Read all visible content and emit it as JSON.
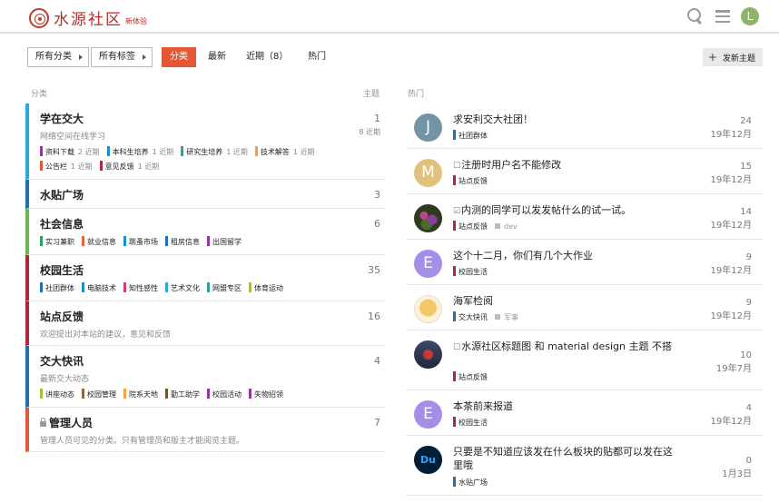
{
  "header": {
    "logo_text": "水源社区",
    "logo_sub": "新体验",
    "avatar_letter": "L",
    "icons": [
      "search-icon",
      "menu-icon"
    ]
  },
  "nav": {
    "all_categories": "所有分类",
    "all_tags": "所有标签",
    "tabs": [
      "分类",
      "最新",
      "近期（8）",
      "热门"
    ],
    "new_topic": "发新主题"
  },
  "columns": {
    "category": "分类",
    "topics": "主题",
    "hot": "热门"
  },
  "categories": [
    {
      "name": "学在交大",
      "color": "#25aae1",
      "count": "1",
      "recent": "8 近期",
      "desc": "网络空间在线学习",
      "subs": [
        {
          "name": "资料下载",
          "color": "#8e3a9c",
          "count": "2 近期"
        },
        {
          "name": "本科生培养",
          "color": "#1b8fc9",
          "count": "1 近期"
        },
        {
          "name": "研究生培养",
          "color": "#26a69a",
          "count": "1 近期"
        },
        {
          "name": "技术解答",
          "color": "#f2a13b",
          "count": "1 近期"
        },
        {
          "name": "公告栏",
          "color": "#e45735",
          "count": "1 近期"
        },
        {
          "name": "意见反馈",
          "color": "#b3243d",
          "count": "1 近期"
        }
      ]
    },
    {
      "name": "水贴广场",
      "color": "#1e6fb5",
      "count": "3",
      "desc": "",
      "subs": []
    },
    {
      "name": "社会信息",
      "color": "#68b84a",
      "count": "6",
      "desc": "",
      "subs": [
        {
          "name": "实习兼职",
          "color": "#2ea06a",
          "count": ""
        },
        {
          "name": "就业信息",
          "color": "#e06a3a",
          "count": ""
        },
        {
          "name": "跳蚤市场",
          "color": "#1b8fc9",
          "count": ""
        },
        {
          "name": "租房信息",
          "color": "#1e6fb5",
          "count": ""
        },
        {
          "name": "出国留学",
          "color": "#8e3a9c",
          "count": ""
        }
      ]
    },
    {
      "name": "校园生活",
      "color": "#b3243d",
      "count": "35",
      "desc": "",
      "subs": [
        {
          "name": "社团群体",
          "color": "#1e6fb5",
          "count": ""
        },
        {
          "name": "电脑技术",
          "color": "#1b8fc9",
          "count": ""
        },
        {
          "name": "知性感性",
          "color": "#d63a6e",
          "count": ""
        },
        {
          "name": "艺术文化",
          "color": "#25aae1",
          "count": ""
        },
        {
          "name": "网盟专区",
          "color": "#26a69a",
          "count": ""
        },
        {
          "name": "体育运动",
          "color": "#9dc23c",
          "count": ""
        }
      ]
    },
    {
      "name": "站点反馈",
      "color": "#b3243d",
      "count": "16",
      "desc": "欢迎提出对本站的建议，意见和反馈",
      "subs": []
    },
    {
      "name": "交大快讯",
      "color": "#1e6fb5",
      "count": "4",
      "desc": "最新交大动态",
      "subs": [
        {
          "name": "讲座动态",
          "color": "#9dc23c",
          "count": ""
        },
        {
          "name": "校园管理",
          "color": "#8a6a3a",
          "count": ""
        },
        {
          "name": "院系天地",
          "color": "#f2a13b",
          "count": ""
        },
        {
          "name": "勤工助学",
          "color": "#6b5a2e",
          "count": ""
        },
        {
          "name": "校园活动",
          "color": "#8e3a9c",
          "count": ""
        },
        {
          "name": "失物招领",
          "color": "#8e3a9c",
          "count": ""
        }
      ]
    },
    {
      "name": "管理人员",
      "color": "#e45735",
      "count": "7",
      "desc": "管理人员可见的分类。只有管理员和版主才能阅览主题。",
      "subs": [],
      "locked": true
    }
  ],
  "topics": [
    {
      "avatar": "J",
      "avatar_color": "#7593a6",
      "title": "求安利交大社团！",
      "marker": "",
      "category": "社团群体",
      "cat_color": "#1e6fb5",
      "tag": "",
      "replies": "24",
      "date": "19年12月"
    },
    {
      "avatar": "M",
      "avatar_color": "#e2c27a",
      "title": "注册时用户名不能修改",
      "marker": "☐",
      "category": "站点反馈",
      "cat_color": "#b3243d",
      "tag": "",
      "replies": "15",
      "date": "19年12月"
    },
    {
      "avatar": "",
      "avatar_style": "img-flowers",
      "title": "内测的同学可以发发帖什么的试一试。",
      "marker": "☑",
      "category": "站点反馈",
      "cat_color": "#b3243d",
      "tag": "dev",
      "replies": "14",
      "date": "19年12月"
    },
    {
      "avatar": "E",
      "avatar_color": "#a58ee8",
      "title": "这个十二月，你们有几个大作业",
      "marker": "",
      "category": "校园生活",
      "cat_color": "#b3243d",
      "tag": "",
      "replies": "9",
      "date": "19年12月"
    },
    {
      "avatar": "",
      "avatar_style": "img-cartoon",
      "title": "海军检阅",
      "marker": "",
      "category": "交大快讯",
      "cat_color": "#1e6fb5",
      "tag": "军事",
      "replies": "9",
      "date": "19年12月"
    },
    {
      "avatar": "",
      "avatar_style": "img-robot",
      "title": "水源社区标题图 和 material design 主题 不搭",
      "marker": "☐",
      "category": "站点反馈",
      "cat_color": "#b3243d",
      "tag": "",
      "replies": "10",
      "date": "19年7月",
      "tall": true
    },
    {
      "avatar": "E",
      "avatar_color": "#a58ee8",
      "title": "本茶前来报道",
      "marker": "",
      "category": "校园生活",
      "cat_color": "#b3243d",
      "tag": "",
      "replies": "4",
      "date": "19年12月"
    },
    {
      "avatar": "Du",
      "avatar_style": "img-du",
      "title": "只要是不知道应该发在什么板块的贴都可以发在这里哦",
      "marker": "",
      "category": "水贴广场",
      "cat_color": "#1e6fb5",
      "tag": "",
      "replies": "0",
      "date": "1月3日",
      "tall": true
    }
  ]
}
